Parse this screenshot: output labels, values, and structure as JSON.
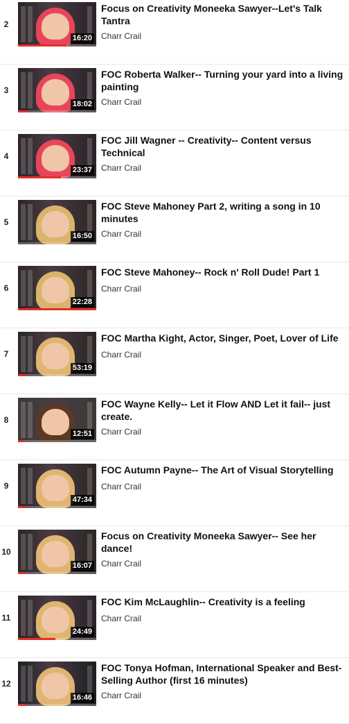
{
  "playlist": {
    "items": [
      {
        "index": "2",
        "title": "Focus on Creativity Moneeka Sawyer--Let's Talk Tantra",
        "channel": "Charr Crail",
        "duration": "16:20",
        "watched": 0.62,
        "hair_color": "#e8455a",
        "bg_color": "#2a2328"
      },
      {
        "index": "3",
        "title": "FOC Roberta Walker-- Turning your yard into a living painting",
        "channel": "Charr Crail",
        "duration": "18:02",
        "watched": 0.12,
        "hair_color": "#e8455a",
        "bg_color": "#2a2328"
      },
      {
        "index": "4",
        "title": "FOC Jill Wagner -- Creativity-- Content versus Technical",
        "channel": "Charr Crail",
        "duration": "23:37",
        "watched": 0.55,
        "hair_color": "#e8455a",
        "bg_color": "#2a2328"
      },
      {
        "index": "5",
        "title": "FOC Steve Mahoney Part 2, writing a song in 10 minutes",
        "channel": "Charr Crail",
        "duration": "16:50",
        "watched": 0.0,
        "hair_color": "#d9b46a",
        "bg_color": "#2b2624"
      },
      {
        "index": "6",
        "title": "FOC Steve Mahoney-- Rock n' Roll Dude! Part 1",
        "channel": "Charr Crail",
        "duration": "22:28",
        "watched": 1.0,
        "hair_color": "#d9b46a",
        "bg_color": "#2b2624"
      },
      {
        "index": "7",
        "title": "FOC Martha Kight, Actor, Singer, Poet, Lover of Life",
        "channel": "Charr Crail",
        "duration": "53:19",
        "watched": 0.1,
        "hair_color": "#e0b571",
        "bg_color": "#2b2624"
      },
      {
        "index": "8",
        "title": "FOC Wayne Kelly-- Let it Flow AND Let it fail-- just create.",
        "channel": "Charr Crail",
        "duration": "12:51",
        "watched": 0.08,
        "hair_color": "#5a3a22",
        "bg_color": "#3a3a36"
      },
      {
        "index": "9",
        "title": "FOC Autumn Payne-- The Art of Visual Storytelling",
        "channel": "Charr Crail",
        "duration": "47:34",
        "watched": 0.1,
        "hair_color": "#e0b571",
        "bg_color": "#2b2624"
      },
      {
        "index": "10",
        "title": "Focus on Creativity Moneeka Sawyer-- See her dance!",
        "channel": "Charr Crail",
        "duration": "16:07",
        "watched": 0.1,
        "hair_color": "#e0b571",
        "bg_color": "#2b2624"
      },
      {
        "index": "11",
        "title": "FOC Kim McLaughlin-- Creativity is a feeling",
        "channel": "Charr Crail",
        "duration": "24:49",
        "watched": 0.48,
        "hair_color": "#e0b571",
        "bg_color": "#2a2328"
      },
      {
        "index": "12",
        "title": "FOC Tonya Hofman, International Speaker and Best-Selling Author (first 16 minutes)",
        "channel": "Charr Crail",
        "duration": "16:46",
        "watched": 0.1,
        "hair_color": "#e0b571",
        "bg_color": "#1f1f22"
      }
    ]
  },
  "colors": {
    "progress_red": "#e52d27",
    "duration_bg": "#000000"
  }
}
